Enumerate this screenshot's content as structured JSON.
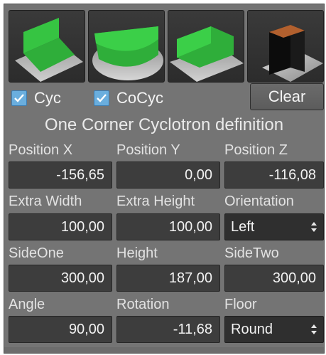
{
  "thumbnails": [
    {
      "icon": "cyc-floor-icon"
    },
    {
      "icon": "cocyc-round-icon"
    },
    {
      "icon": "corner-cyc-icon"
    },
    {
      "icon": "dark-box-icon"
    }
  ],
  "checkboxes": {
    "cyc": {
      "label": "Cyc",
      "checked": true
    },
    "cocyc": {
      "label": "CoCyc",
      "checked": true
    }
  },
  "clear_label": "Clear",
  "title": "One Corner Cyclotron definition",
  "fields": {
    "position_x": {
      "label": "Position X",
      "value": "-156,65"
    },
    "position_y": {
      "label": "Position Y",
      "value": "0,00"
    },
    "position_z": {
      "label": "Position Z",
      "value": "-116,08"
    },
    "extra_width": {
      "label": "Extra Width",
      "value": "100,00"
    },
    "extra_height": {
      "label": "Extra Height",
      "value": "100,00"
    },
    "orientation": {
      "label": "Orientation",
      "value": "Left"
    },
    "side_one": {
      "label": "SideOne",
      "value": "300,00"
    },
    "height": {
      "label": "Height",
      "value": "187,00"
    },
    "side_two": {
      "label": "SideTwo",
      "value": "300,00"
    },
    "angle": {
      "label": "Angle",
      "value": "90,00"
    },
    "rotation": {
      "label": "Rotation",
      "value": "-11,68"
    },
    "floor": {
      "label": "Floor",
      "value": "Round"
    }
  },
  "colors": {
    "panel": "#747474",
    "field": "#3d3d3d",
    "checkbox": "#6aaede",
    "green": "#2fae3a"
  }
}
